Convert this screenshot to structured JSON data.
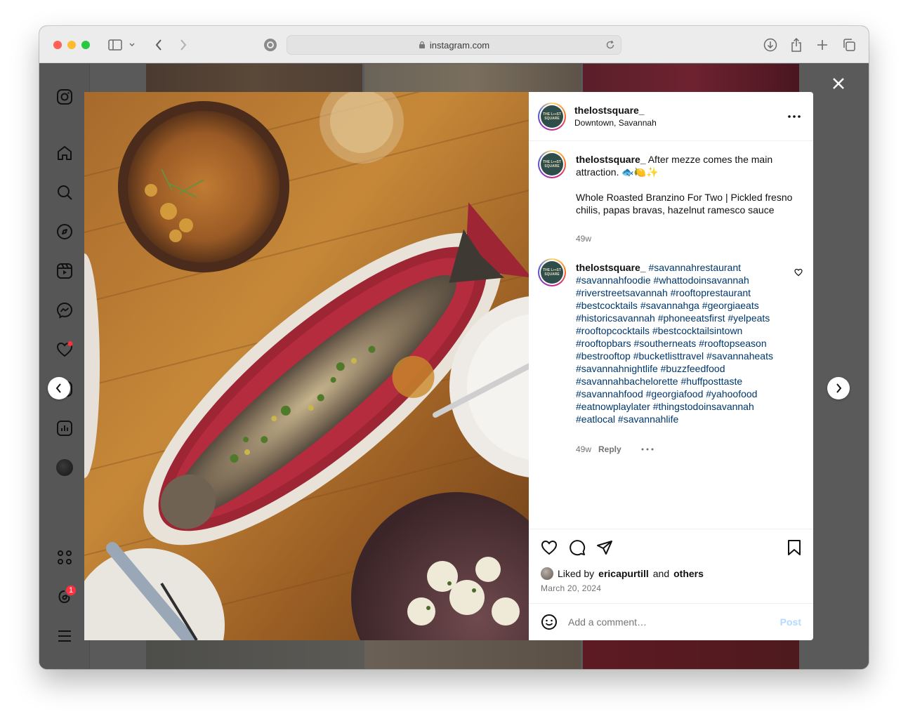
{
  "browser": {
    "url": "instagram.com"
  },
  "post": {
    "username": "thelostsquare_",
    "location": "Downtown, Savannah",
    "avatar_text": "THE L⊶ST SQUARE",
    "caption_line1": "After mezze comes the main attraction. 🐟🍋✨",
    "caption_line2": "Whole Roasted Branzino For Two | Pickled fresno chilis, papas bravas, hazelnut ramesco sauce",
    "caption_time": "49w",
    "comment_hashtags": "#savannahrestaurant #savannahfoodie #whattodoinsavannah #riverstreetsavannah #rooftoprestaurant #bestcocktails #savannahga #georgiaeats #historicsavannah #phoneeatsfirst #yelpeats #rooftopcocktails #bestcocktailsintown #rooftopbars #southerneats #rooftopseason #bestrooftop #bucketlisttravel #savannaheats #savannahnightlife #buzzfeedfood #savannahbachelorette #huffposttaste #savannahfood #georgiafood #yahoofood #eatnowplaylater #thingstodoinsavannah #eatlocal #savannahlife",
    "comment_time": "49w",
    "reply_label": "Reply",
    "liked_by_prefix": "Liked by",
    "liked_by_user": "ericapurtill",
    "liked_by_and": "and",
    "liked_by_others": "others",
    "date": "March 20, 2024",
    "comment_placeholder": "Add a comment…",
    "post_label": "Post"
  },
  "sidebar": {
    "notification_badge": "1"
  },
  "icons": [
    "instagram-icon",
    "home-icon",
    "search-icon",
    "explore-icon",
    "reels-icon",
    "messenger-icon",
    "heart-icon",
    "create-icon",
    "dashboard-icon",
    "profile-avatar",
    "threads-icon",
    "more-menu-icon"
  ],
  "colors": {
    "link": "#00376b",
    "post_disabled": "#b3dbff"
  }
}
